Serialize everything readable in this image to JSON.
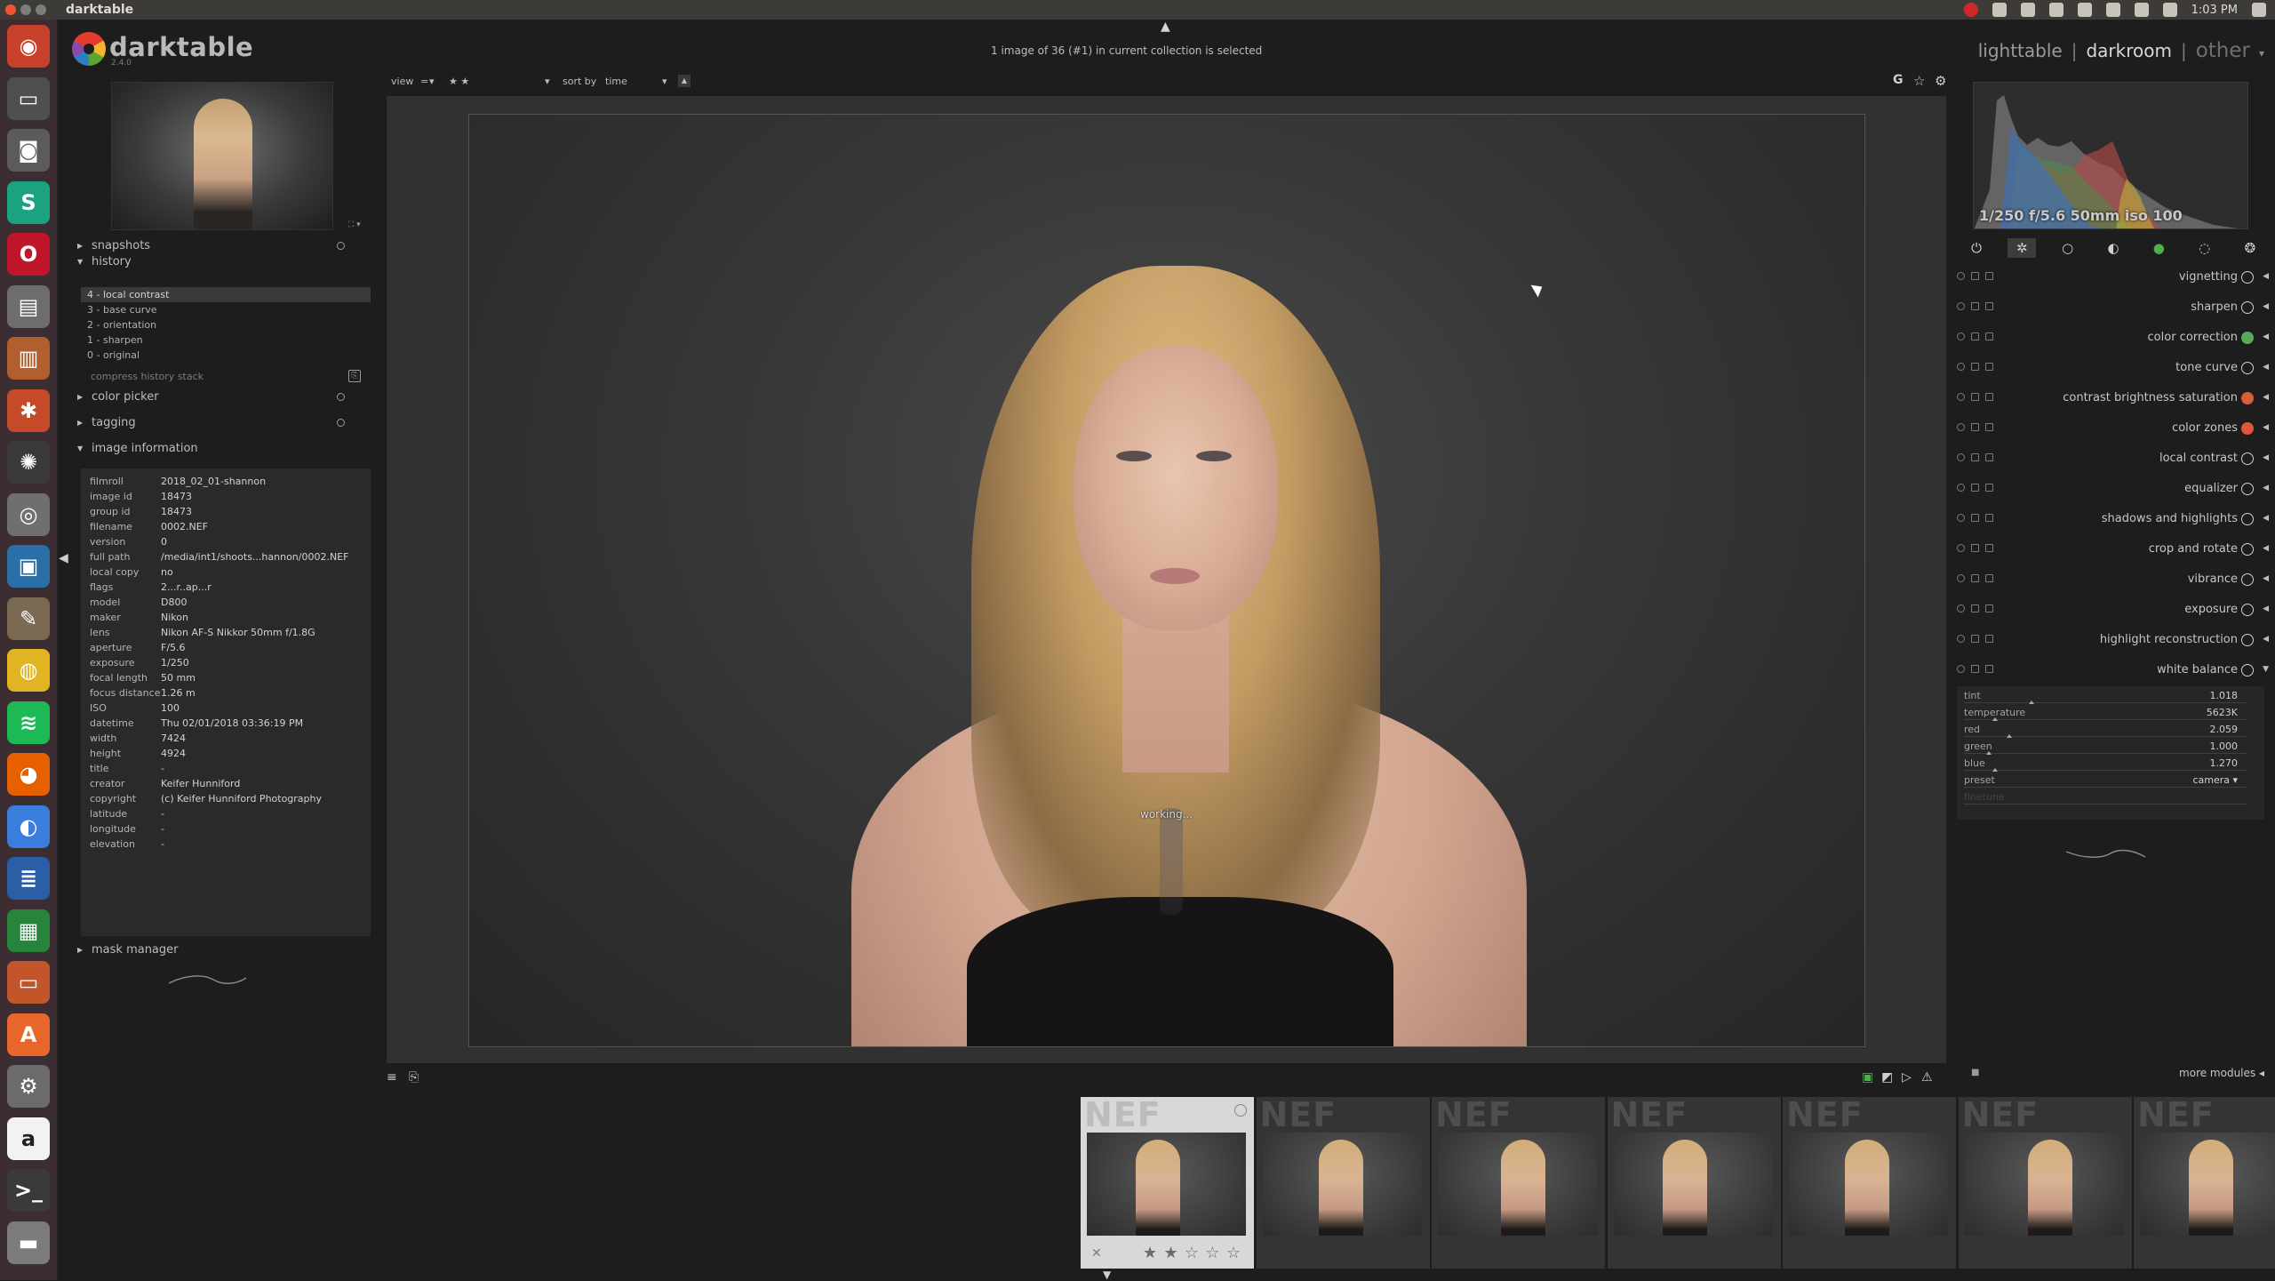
{
  "system": {
    "app_title": "darktable",
    "clock": "1:03 PM",
    "launcher_icons": [
      {
        "name": "dash-icon",
        "glyph": "◉",
        "color": "#c8412b"
      },
      {
        "name": "presentation-icon",
        "glyph": "▭",
        "color": "#4f4f4f"
      },
      {
        "name": "camera-icon",
        "glyph": "◙",
        "color": "#5b5b5b"
      },
      {
        "name": "s-app-icon",
        "glyph": "S",
        "color": "#1aa37e"
      },
      {
        "name": "opera-icon",
        "glyph": "O",
        "color": "#c0162b"
      },
      {
        "name": "printer-icon",
        "glyph": "▤",
        "color": "#6d6d6d"
      },
      {
        "name": "files-icon",
        "glyph": "▥",
        "color": "#b15f31"
      },
      {
        "name": "bolts-icon",
        "glyph": "✱",
        "color": "#c54a2a"
      },
      {
        "name": "darktable-icon",
        "glyph": "✺",
        "color": "#3a3a3a"
      },
      {
        "name": "screenshot-icon",
        "glyph": "◎",
        "color": "#6f6f6f"
      },
      {
        "name": "photo-viewer-icon",
        "glyph": "▣",
        "color": "#2b6fa8"
      },
      {
        "name": "gimp-icon",
        "glyph": "✎",
        "color": "#7a6a52"
      },
      {
        "name": "rhythmbox-icon",
        "glyph": "◍",
        "color": "#e0b422"
      },
      {
        "name": "spotify-icon",
        "glyph": "≋",
        "color": "#1db954"
      },
      {
        "name": "firefox-icon",
        "glyph": "◕",
        "color": "#e66000"
      },
      {
        "name": "chrome-icon",
        "glyph": "◐",
        "color": "#3b7ddd"
      },
      {
        "name": "writer-icon",
        "glyph": "≣",
        "color": "#2a5fa8"
      },
      {
        "name": "calc-icon",
        "glyph": "▦",
        "color": "#27853b"
      },
      {
        "name": "impress-icon",
        "glyph": "▭",
        "color": "#c2562a"
      },
      {
        "name": "software-center-icon",
        "glyph": "A",
        "color": "#e8662a"
      },
      {
        "name": "settings-icon",
        "glyph": "⚙",
        "color": "#6b6b6b"
      },
      {
        "name": "amazon-icon",
        "glyph": "a",
        "color": "#f2f2f2"
      },
      {
        "name": "terminal-icon",
        "glyph": ">_",
        "color": "#3a3a3a"
      },
      {
        "name": "drive-icon",
        "glyph": "▬",
        "color": "#7b7b7b"
      }
    ]
  },
  "header": {
    "logo_text": "darktable",
    "version": "2.4.0",
    "collection_info": "1 image of 36 (#1) in current collection is selected",
    "views": {
      "lighttable": "lighttable",
      "darkroom": "darkroom",
      "other": "other",
      "sep": "|"
    }
  },
  "toolbar": {
    "view_label": "view",
    "view_op": "=",
    "view_stars": "★ ★",
    "sort_label": "sort by",
    "sort_value": "time",
    "sort_dir": "▲",
    "grouping_icon": "G",
    "star_icon": "☆",
    "prefs_icon": "⚙"
  },
  "left": {
    "sections": {
      "snapshots": "snapshots",
      "history": "history",
      "color_picker": "color picker",
      "tagging": "tagging",
      "image_information": "image information",
      "mask_manager": "mask manager"
    },
    "history_items": [
      "4 - local contrast",
      "3 - base curve",
      "2 - orientation",
      "1 - sharpen",
      "0 - original"
    ],
    "compress_history": "compress history stack",
    "image_info": [
      {
        "k": "filmroll",
        "v": "2018_02_01-shannon"
      },
      {
        "k": "image id",
        "v": "18473"
      },
      {
        "k": "group id",
        "v": "18473"
      },
      {
        "k": "filename",
        "v": "0002.NEF"
      },
      {
        "k": "version",
        "v": "0"
      },
      {
        "k": "full path",
        "v": "/media/int1/shoots...hannon/0002.NEF"
      },
      {
        "k": "local copy",
        "v": "no"
      },
      {
        "k": "flags",
        "v": "2...r..ap...r"
      },
      {
        "k": "model",
        "v": "D800"
      },
      {
        "k": "maker",
        "v": "Nikon"
      },
      {
        "k": "lens",
        "v": "Nikon AF-S Nikkor 50mm f/1.8G"
      },
      {
        "k": "aperture",
        "v": "F/5.6"
      },
      {
        "k": "exposure",
        "v": "1/250"
      },
      {
        "k": "focal length",
        "v": "50 mm"
      },
      {
        "k": "focus distance",
        "v": "1.26 m"
      },
      {
        "k": "ISO",
        "v": "100"
      },
      {
        "k": "datetime",
        "v": "Thu 02/01/2018 03:36:19 PM"
      },
      {
        "k": "width",
        "v": "7424"
      },
      {
        "k": "height",
        "v": "4924"
      },
      {
        "k": "title",
        "v": "-"
      },
      {
        "k": "creator",
        "v": "Keifer Hunniford"
      },
      {
        "k": "copyright",
        "v": "(c) Keifer Hunniford Photography"
      },
      {
        "k": "latitude",
        "v": "-"
      },
      {
        "k": "longitude",
        "v": "-"
      },
      {
        "k": "elevation",
        "v": "-"
      }
    ]
  },
  "center": {
    "working_label": "working..."
  },
  "right": {
    "histogram_info": "1/250 f/5.6 50mm iso 100",
    "group_tabs": [
      {
        "name": "power-icon",
        "glyph": "⏻"
      },
      {
        "name": "favourites-icon",
        "glyph": "✲"
      },
      {
        "name": "basic-group-icon",
        "glyph": "○"
      },
      {
        "name": "tone-group-icon",
        "glyph": "◐"
      },
      {
        "name": "color-group-icon",
        "glyph": "●"
      },
      {
        "name": "correct-group-icon",
        "glyph": "◌"
      },
      {
        "name": "effect-group-icon",
        "glyph": "❂"
      }
    ],
    "modules": [
      {
        "name": "vignetting",
        "color": "#cfcfcf"
      },
      {
        "name": "sharpen",
        "color": "#cfcfcf"
      },
      {
        "name": "color correction",
        "color": "#5aa85a"
      },
      {
        "name": "tone curve",
        "color": "#cfcfcf"
      },
      {
        "name": "contrast brightness saturation",
        "color": "#d85e3a"
      },
      {
        "name": "color zones",
        "color": "#e0553c"
      },
      {
        "name": "local contrast",
        "color": "#cfcfcf"
      },
      {
        "name": "equalizer",
        "color": "#cfcfcf"
      },
      {
        "name": "shadows and highlights",
        "color": "#cfcfcf"
      },
      {
        "name": "crop and rotate",
        "color": "#cfcfcf"
      },
      {
        "name": "vibrance",
        "color": "#cfcfcf"
      },
      {
        "name": "exposure",
        "color": "#cfcfcf"
      },
      {
        "name": "highlight reconstruction",
        "color": "#cfcfcf"
      },
      {
        "name": "white balance",
        "color": "#cfcfcf"
      }
    ],
    "white_balance": [
      {
        "k": "tint",
        "v": "1.018",
        "pos": 0.23
      },
      {
        "k": "temperature",
        "v": "5623K",
        "pos": 0.1
      },
      {
        "k": "red",
        "v": "2.059",
        "pos": 0.15
      },
      {
        "k": "green",
        "v": "1.000",
        "pos": 0.08
      },
      {
        "k": "blue",
        "v": "1.270",
        "pos": 0.1
      },
      {
        "k": "preset",
        "v": "camera ▾",
        "pos": null
      },
      {
        "k": "finetune",
        "v": "",
        "pos": null
      }
    ],
    "more_modules": "more modules ◂"
  },
  "filmstrip": {
    "label": "NEF",
    "count": 7,
    "selected_index": 0,
    "stars": [
      "★",
      "★",
      "☆",
      "☆",
      "☆"
    ],
    "reject": "✕"
  }
}
